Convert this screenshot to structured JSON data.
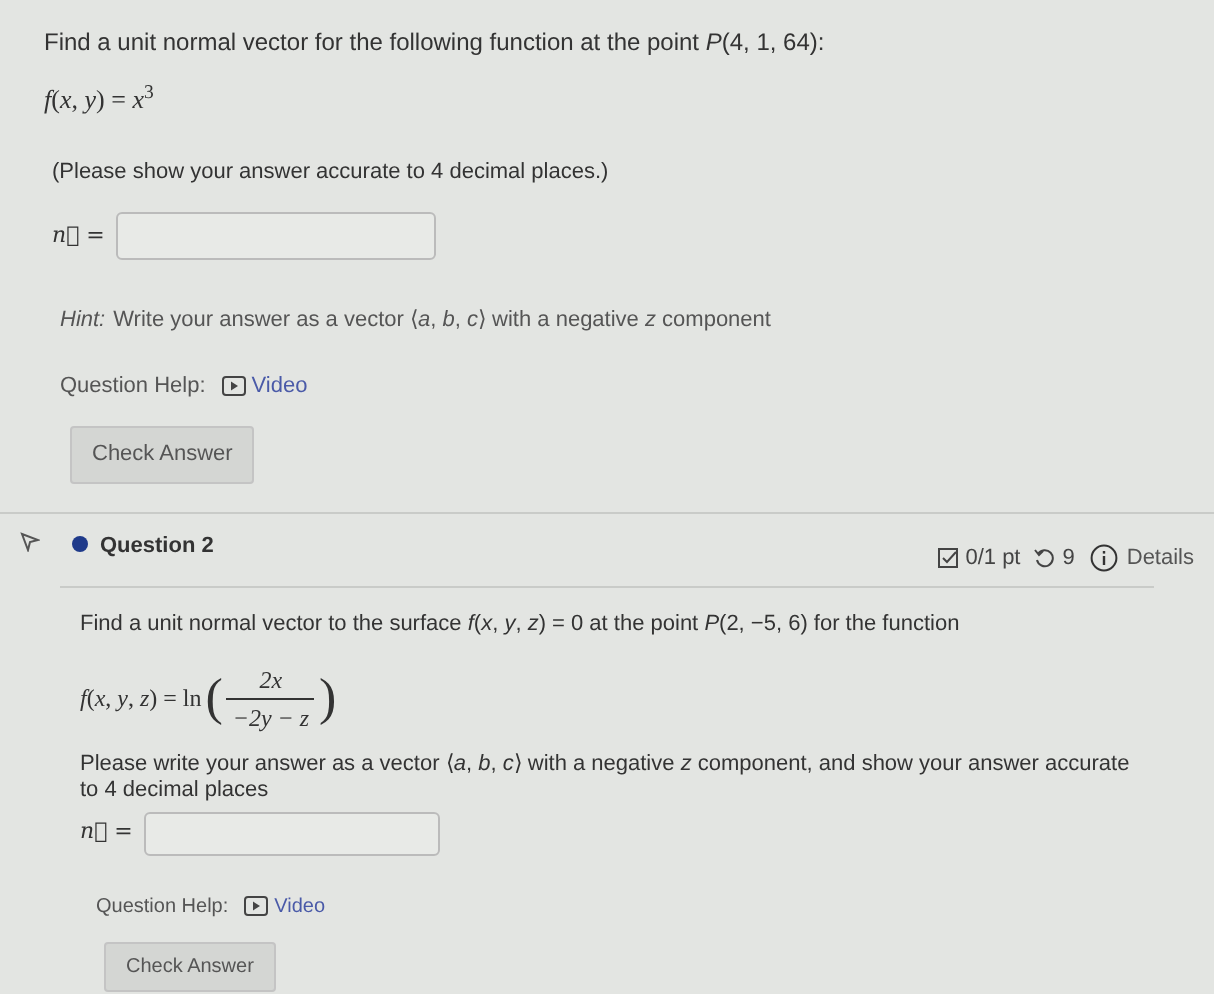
{
  "question1": {
    "prompt": "Find a unit normal vector for the following function at the point *P*(4, 1, 64):",
    "function": "*f*(*x*, *y*) = *x*$^{3}$",
    "note": "(Please show your answer accurate to 4 decimal places.)",
    "answer_label": "n⃗ =",
    "hint_label": "Hint:",
    "hint": "Write your answer as a vector ⟨*a*, *b*, *c*⟩ with a negative *z* component",
    "help_label": "Question Help:",
    "help_link": "Video",
    "button": "Check Answer"
  },
  "question2": {
    "title": "Question 2",
    "score": "0/1 pt",
    "attempts": "9",
    "details": "Details",
    "prompt": "Find a unit normal vector to the surface *f*(*x*, *y*, *z*) = 0 at the point *P*(2, −5, 6) for the function",
    "function_lhs": "*f*(*x*, *y*, *z*) = ln",
    "open": "(",
    "numerator": "2x",
    "denominator": "−2y − z",
    "close": ")",
    "note": "Please write your answer as a vector ⟨*a*, *b*, *c*⟩ with a negative *z* component, and show your answer accurate to 4 decimal places",
    "answer_label": "n⃗ =",
    "help_label": "Question Help:",
    "help_link": "Video",
    "button": "Check Answer"
  }
}
